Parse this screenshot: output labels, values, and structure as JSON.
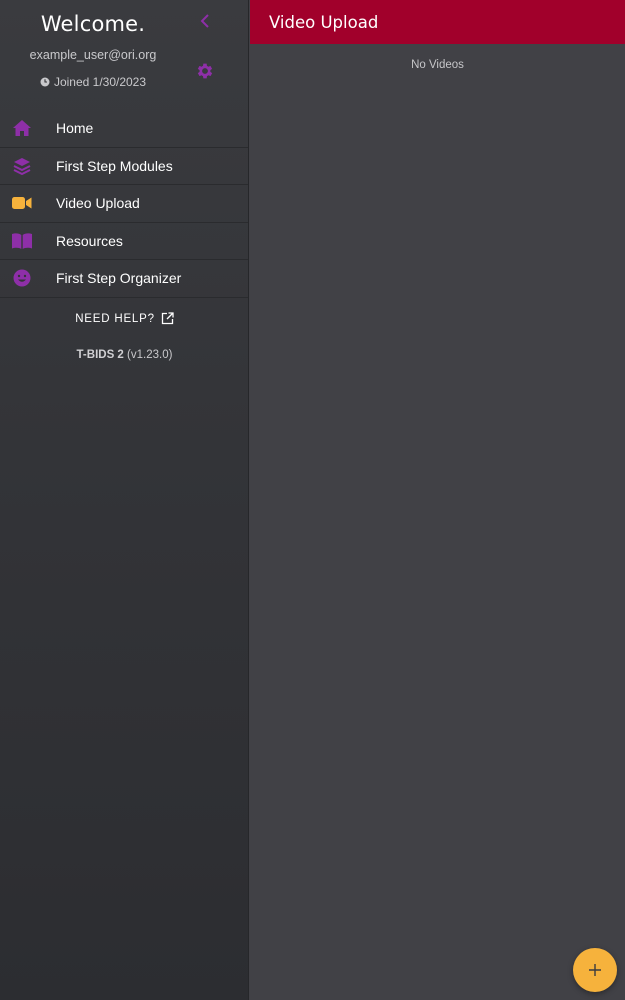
{
  "sidebar": {
    "welcome": "Welcome.",
    "email": "example_user@ori.org",
    "joined": "Joined 1/30/2023",
    "collapse_icon": "chevron-left-icon",
    "settings_icon": "gear-icon",
    "items": [
      {
        "label": "Home",
        "icon": "home-icon",
        "icon_color": "#8e2fa8"
      },
      {
        "label": "First Step Modules",
        "icon": "layers-icon",
        "icon_color": "#8e2fa8"
      },
      {
        "label": "Video Upload",
        "icon": "video-camera-icon",
        "icon_color": "#f6b23c"
      },
      {
        "label": "Resources",
        "icon": "book-icon",
        "icon_color": "#8e2fa8"
      },
      {
        "label": "First Step Organizer",
        "icon": "smile-icon",
        "icon_color": "#8e2fa8"
      }
    ],
    "need_help": "NEED HELP?",
    "app_name": "T-BIDS 2",
    "version": "(v1.23.0)"
  },
  "header": {
    "title": "Video Upload",
    "color": "#a1002b"
  },
  "main": {
    "empty_text": "No Videos"
  },
  "fab": {
    "icon": "plus-icon",
    "color": "#f6b23c"
  }
}
